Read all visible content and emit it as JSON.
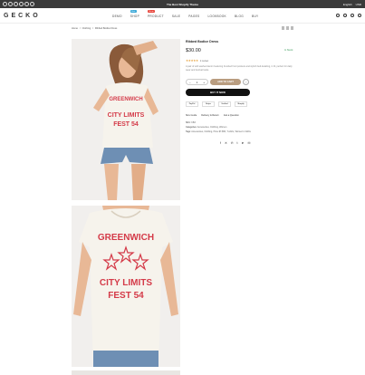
{
  "topbar": {
    "promo": "The Best Shopify Theme",
    "language": "English",
    "currency": "USD",
    "social_icons": [
      "facebook-icon",
      "twitter-icon",
      "instagram-icon",
      "linkedin-icon",
      "youtube-icon",
      "pinterest-icon"
    ]
  },
  "header": {
    "logo": "GECKO",
    "nav": [
      {
        "label": "DEMO",
        "badge": ""
      },
      {
        "label": "SHOP",
        "badge": "Hot",
        "badge_color": "#3aa8d8"
      },
      {
        "label": "PRODUCT",
        "badge": "New",
        "badge_color": "#e8443a"
      },
      {
        "label": "SALE",
        "badge": ""
      },
      {
        "label": "PAGES",
        "badge": ""
      },
      {
        "label": "LOOKBOOK",
        "badge": ""
      },
      {
        "label": "BLOG",
        "badge": ""
      },
      {
        "label": "BUY",
        "badge": ""
      }
    ],
    "icons": [
      "search-icon",
      "user-icon",
      "heart-icon",
      "cart-icon"
    ]
  },
  "breadcrumb": [
    "Home",
    "Clothing",
    "Ribbed Bodice Dress"
  ],
  "gallery": {
    "shirt_line1": "GREENWICH",
    "shirt_line2": "CITY LIMITS",
    "shirt_line3": "FEST 54"
  },
  "product": {
    "title": "Ribbed Bodice Dress",
    "price": "$30.00",
    "stock": "In Stock",
    "stars": "★★★★★",
    "reviews": "1 review",
    "description": "A pair of soft washed denim featuring brushed front pockets and stylish belt detailing, in fit, perfect for daily wear and festival looks.",
    "quantity": "1",
    "minus": "−",
    "plus": "+",
    "add_to_cart": "ADD TO CART",
    "buy_now": "BUY IT NOW",
    "payments": [
      "PayPal",
      "Stripe",
      "Verified",
      "Shopify"
    ],
    "links": [
      "Size Guide",
      "Delivery & Return",
      "Ask a Question"
    ],
    "sku_label": "SKU:",
    "sku": "KB3",
    "categories_label": "Categories:",
    "categories": "Accessories, Clothing, Women",
    "tags_label": "Tags:",
    "tags": "Accessories, Clothing, Price $7-$50, T-shirts, Women's Cloths",
    "share_icons": [
      "facebook-icon",
      "twitter-icon",
      "pinterest-icon",
      "tumblr-icon",
      "telegram-icon",
      "email-icon"
    ]
  },
  "colors": {
    "topbar": "#3a3a3a",
    "accent": "#b99d80",
    "shirt_print": "#d43a48",
    "star": "#e6a23c"
  }
}
